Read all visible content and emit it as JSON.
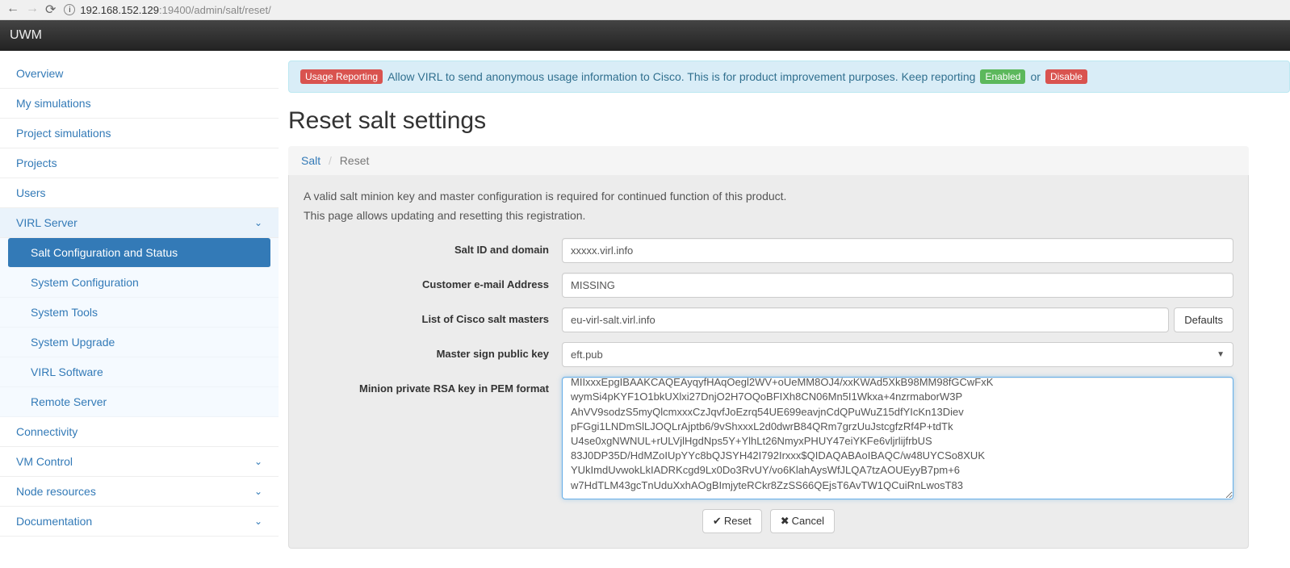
{
  "browser": {
    "url_host": "192.168.152.129",
    "url_rest": ":19400/admin/salt/reset/"
  },
  "header": {
    "brand": "UWM"
  },
  "sidebar": {
    "overview": "Overview",
    "my_simulations": "My simulations",
    "project_simulations": "Project simulations",
    "projects": "Projects",
    "users": "Users",
    "virl_server": "VIRL Server",
    "virl_children": {
      "salt": "Salt Configuration and Status",
      "system_config": "System Configuration",
      "system_tools": "System Tools",
      "system_upgrade": "System Upgrade",
      "virl_software": "VIRL Software",
      "remote_server": "Remote Server"
    },
    "connectivity": "Connectivity",
    "vm_control": "VM Control",
    "node_resources": "Node resources",
    "documentation": "Documentation"
  },
  "alert": {
    "badge": "Usage Reporting",
    "text": "Allow VIRL to send anonymous usage information to Cisco. This is for product improvement purposes. Keep reporting",
    "enabled": "Enabled",
    "or": "or",
    "disable": "Disable"
  },
  "page": {
    "title": "Reset salt settings",
    "breadcrumb_salt": "Salt",
    "breadcrumb_reset": "Reset",
    "intro1": "A valid salt minion key and master configuration is required for continued function of this product.",
    "intro2": "This page allows updating and resetting this registration."
  },
  "form": {
    "salt_id_label": "Salt ID and domain",
    "salt_id_value": "xxxxx.virl.info",
    "email_label": "Customer e-mail Address",
    "email_value": "MISSING",
    "masters_label": "List of Cisco salt masters",
    "masters_value": "eu-virl-salt.virl.info",
    "defaults_btn": "Defaults",
    "pubkey_label": "Master sign public key",
    "pubkey_value": "eft.pub",
    "pem_label": "Minion private RSA key in PEM format",
    "pem_value": "-----BEGIN RSA PRIVATE KEY-----\nMIIxxxEpgIBAAKCAQEAyqyfHAqOegl2WV+oUeMM8OJ4/xxKWAd5XkB98MM98fGCwFxK\nwymSi4pKYF1O1bkUXlxi27DnjO2H7OQoBFIXh8CN06Mn5I1Wkxa+4nzrmaborW3P\nAhVV9sodzS5myQlcmxxxCzJqvfJoEzrq54UE699eavjnCdQPuWuZ15dfYIcKn13Diev\npFGgi1LNDmSlLJOQLrAjptb6/9vShxxxL2d0dwrB84QRm7grzUuJstcgfzRf4P+tdTk\nU4se0xgNWNUL+rULVjlHgdNps5Y+YlhLt26NmyxPHUY47eiYKFe6vljrlijfrbUS\n83J0DP35D/HdMZoIUpYYc8bQJSYH42I792Irxxx$QIDAQABAoIBAQC/w48UYCSo8XUK\nYUkImdUvwokLkIADRKcgd9Lx0Do3RvUY/vo6KlahAysWfJLQA7tzAOUEyyB7pm+6\nw7HdTLM43gcTnUduXxhAOgBImjyteRCkr8ZzSS66QEjsT6AvTW1QCuiRnLwosT83",
    "reset_btn": "Reset",
    "cancel_btn": "Cancel"
  }
}
